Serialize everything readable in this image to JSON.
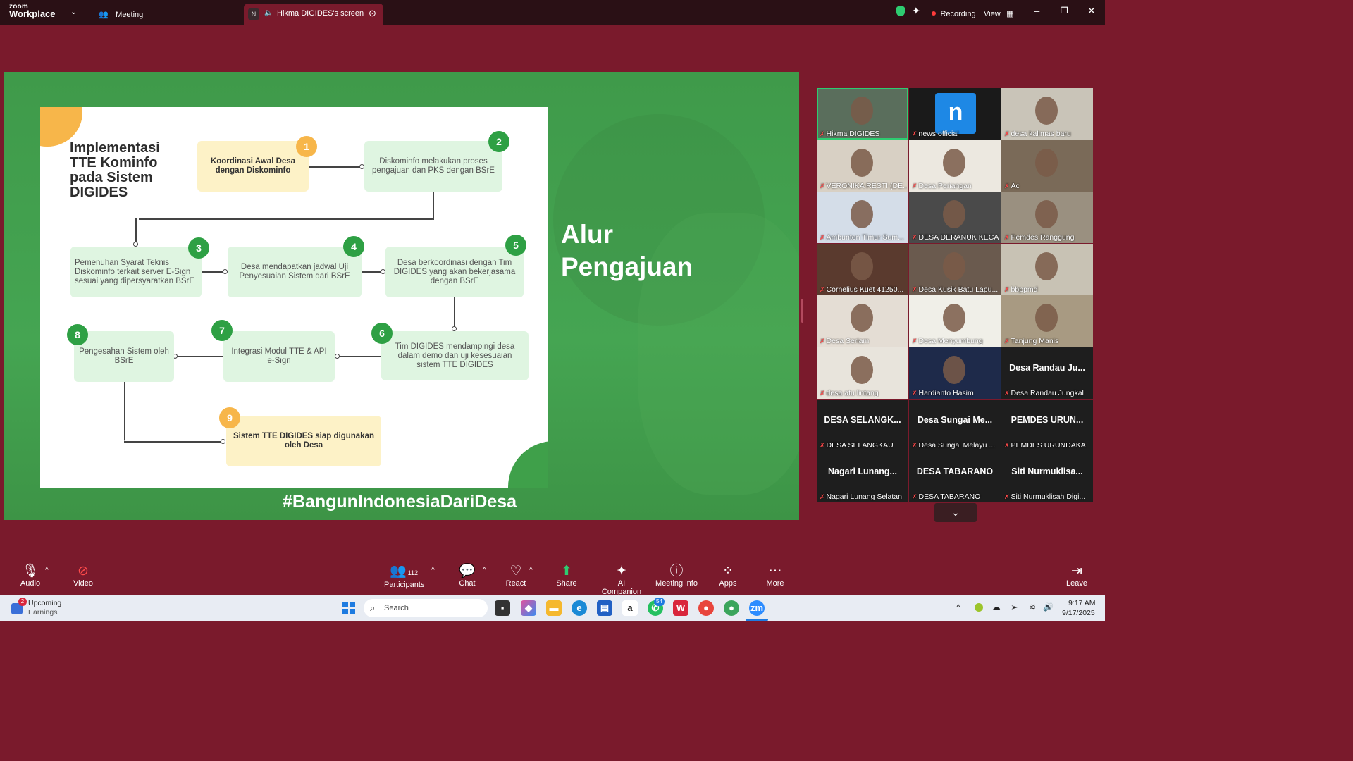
{
  "titlebar": {
    "logo_top": "zoom",
    "logo_bottom": "Workplace",
    "meeting_label": "Meeting",
    "screen_tab_initial": "N",
    "screen_tab_label": "Hikma DIGIDES's screen",
    "recording_label": "Recording",
    "view_label": "View"
  },
  "slide": {
    "title": "Implementasi TTE Kominfo pada Sistem DIGIDES",
    "side_title_line1": "Alur",
    "side_title_line2": "Pengajuan",
    "hashtag": "#BangunIndonesiaDariDesa",
    "steps": [
      {
        "num": "1",
        "text": "Koordinasi Awal Desa dengan Diskominfo"
      },
      {
        "num": "2",
        "text": "Diskominfo melakukan proses pengajuan dan PKS dengan BSrE"
      },
      {
        "num": "3",
        "text": "Pemenuhan Syarat Teknis Diskominfo terkait server E-Sign sesuai yang dipersyaratkan BSrE"
      },
      {
        "num": "4",
        "text": "Desa mendapatkan jadwal Uji Penyesuaian Sistem dari BSrE"
      },
      {
        "num": "5",
        "text": "Desa berkoordinasi dengan Tim DIGIDES yang akan bekerjasama dengan BSrE"
      },
      {
        "num": "6",
        "text": "Tim DIGIDES mendampingi desa dalam demo dan uji kesesuaian sistem TTE DIGIDES"
      },
      {
        "num": "7",
        "text": "Integrasi Modul TTE  & API e-Sign"
      },
      {
        "num": "8",
        "text": "Pengesahan Sistem oleh BSrE"
      },
      {
        "num": "9",
        "text": "Sistem TTE DIGIDES siap digunakan oleh Desa"
      }
    ]
  },
  "gallery": {
    "participants": [
      {
        "name": "Hikma DIGIDES",
        "big": ""
      },
      {
        "name": "news official",
        "big": ""
      },
      {
        "name": "desa kalimas baru",
        "big": ""
      },
      {
        "name": "VERONIKA RESTI (DE...",
        "big": ""
      },
      {
        "name": "Desa Periangan",
        "big": ""
      },
      {
        "name": "Ac",
        "big": ""
      },
      {
        "name": "Ambunten Timur Sum...",
        "big": ""
      },
      {
        "name": "DESA DERANUK KECAM...",
        "big": ""
      },
      {
        "name": "Pemdes Ranggung",
        "big": ""
      },
      {
        "name": "Cornelius Kuet 41250...",
        "big": ""
      },
      {
        "name": "Desa Kusik Batu Lapu...",
        "big": ""
      },
      {
        "name": "bbppmd",
        "big": ""
      },
      {
        "name": "Desa Seriam",
        "big": ""
      },
      {
        "name": "Desa Menyumbung",
        "big": ""
      },
      {
        "name": "Tanjung Manis",
        "big": ""
      },
      {
        "name": "desa atu lintang",
        "big": ""
      },
      {
        "name": "Hardianto Hasim",
        "big": ""
      },
      {
        "name": "Desa Randau Jungkal",
        "big": "Desa Randau Ju..."
      },
      {
        "name": "DESA SELANGKAU",
        "big": "DESA SELANGK..."
      },
      {
        "name": "Desa Sungai Melayu ...",
        "big": "Desa Sungai Me..."
      },
      {
        "name": "PEMDES URUNDAKA",
        "big": "PEMDES URUN..."
      },
      {
        "name": "Nagari Lunang Selatan",
        "big": "Nagari Lunang..."
      },
      {
        "name": "DESA TABARANO",
        "big": "DESA TABARANO"
      },
      {
        "name": "Siti Nurmuklisah Digi...",
        "big": "Siti Nurmuklisa..."
      }
    ],
    "news_initial": "n"
  },
  "toolbar": {
    "audio": "Audio",
    "video": "Video",
    "participants": "Participants",
    "participants_count": "112",
    "chat": "Chat",
    "react": "React",
    "share": "Share",
    "ai_companion": "AI Companion",
    "meeting_info": "Meeting info",
    "apps": "Apps",
    "more": "More",
    "leave": "Leave"
  },
  "taskbar": {
    "widget_badge": "2",
    "widget_title": "Upcoming",
    "widget_sub": "Earnings",
    "search_placeholder": "Search",
    "whatsapp_badge": "54",
    "time": "9:17 AM",
    "date": "9/17/2025"
  },
  "colors": {
    "zoom_bg": "#7a1a2c",
    "slide_green": "#45a552",
    "accent_orange": "#f7b64a",
    "accent_green": "#2ea044"
  }
}
